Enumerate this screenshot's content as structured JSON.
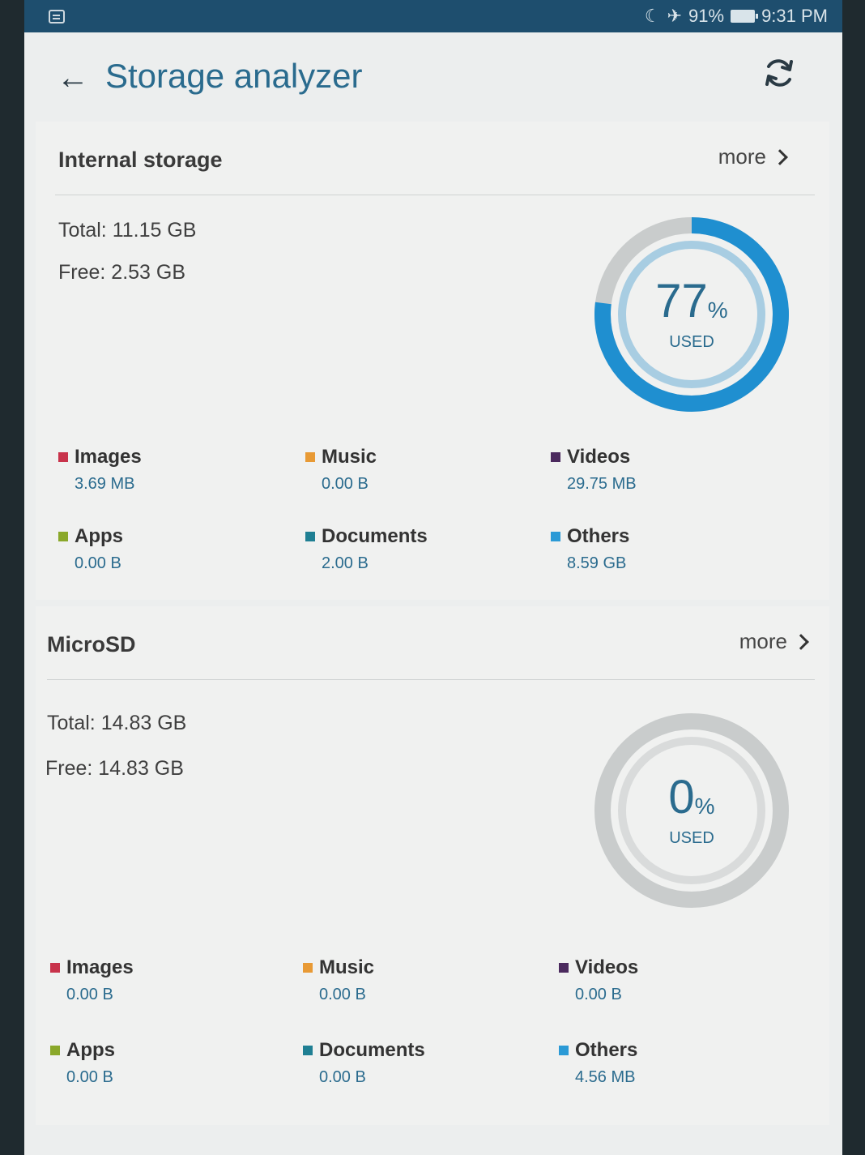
{
  "status": {
    "battery": "91%",
    "time": "9:31 PM"
  },
  "header": {
    "title": "Storage analyzer"
  },
  "colors": {
    "accent": "#2a6b8e",
    "ring_used": "#1f8fd0",
    "ring_bg": "#c9cccc",
    "images": "#c8334b",
    "music": "#e89a35",
    "videos": "#4b2a5e",
    "apps": "#8aa82a",
    "documents": "#1f7f93",
    "others": "#2b9ad6"
  },
  "internal": {
    "title": "Internal storage",
    "more": "more",
    "total": "Total: 11.15 GB",
    "free": "Free: 2.53 GB",
    "used_pct": "77",
    "used_fraction": 0.77,
    "pct_sign": "%",
    "used_label": "USED",
    "categories": [
      {
        "name": "Images",
        "value": "3.69 MB"
      },
      {
        "name": "Music",
        "value": "0.00 B"
      },
      {
        "name": "Videos",
        "value": "29.75 MB"
      },
      {
        "name": "Apps",
        "value": "0.00 B"
      },
      {
        "name": "Documents",
        "value": "2.00 B"
      },
      {
        "name": "Others",
        "value": "8.59 GB"
      }
    ]
  },
  "microsd": {
    "title": "MicroSD",
    "more": "more",
    "total": "Total: 14.83 GB",
    "free": "Free: 14.83 GB",
    "used_pct": "0",
    "used_fraction": 0,
    "pct_sign": "%",
    "used_label": "USED",
    "categories": [
      {
        "name": "Images",
        "value": "0.00 B"
      },
      {
        "name": "Music",
        "value": "0.00 B"
      },
      {
        "name": "Videos",
        "value": "0.00 B"
      },
      {
        "name": "Apps",
        "value": "0.00 B"
      },
      {
        "name": "Documents",
        "value": "0.00 B"
      },
      {
        "name": "Others",
        "value": "4.56 MB"
      }
    ]
  }
}
